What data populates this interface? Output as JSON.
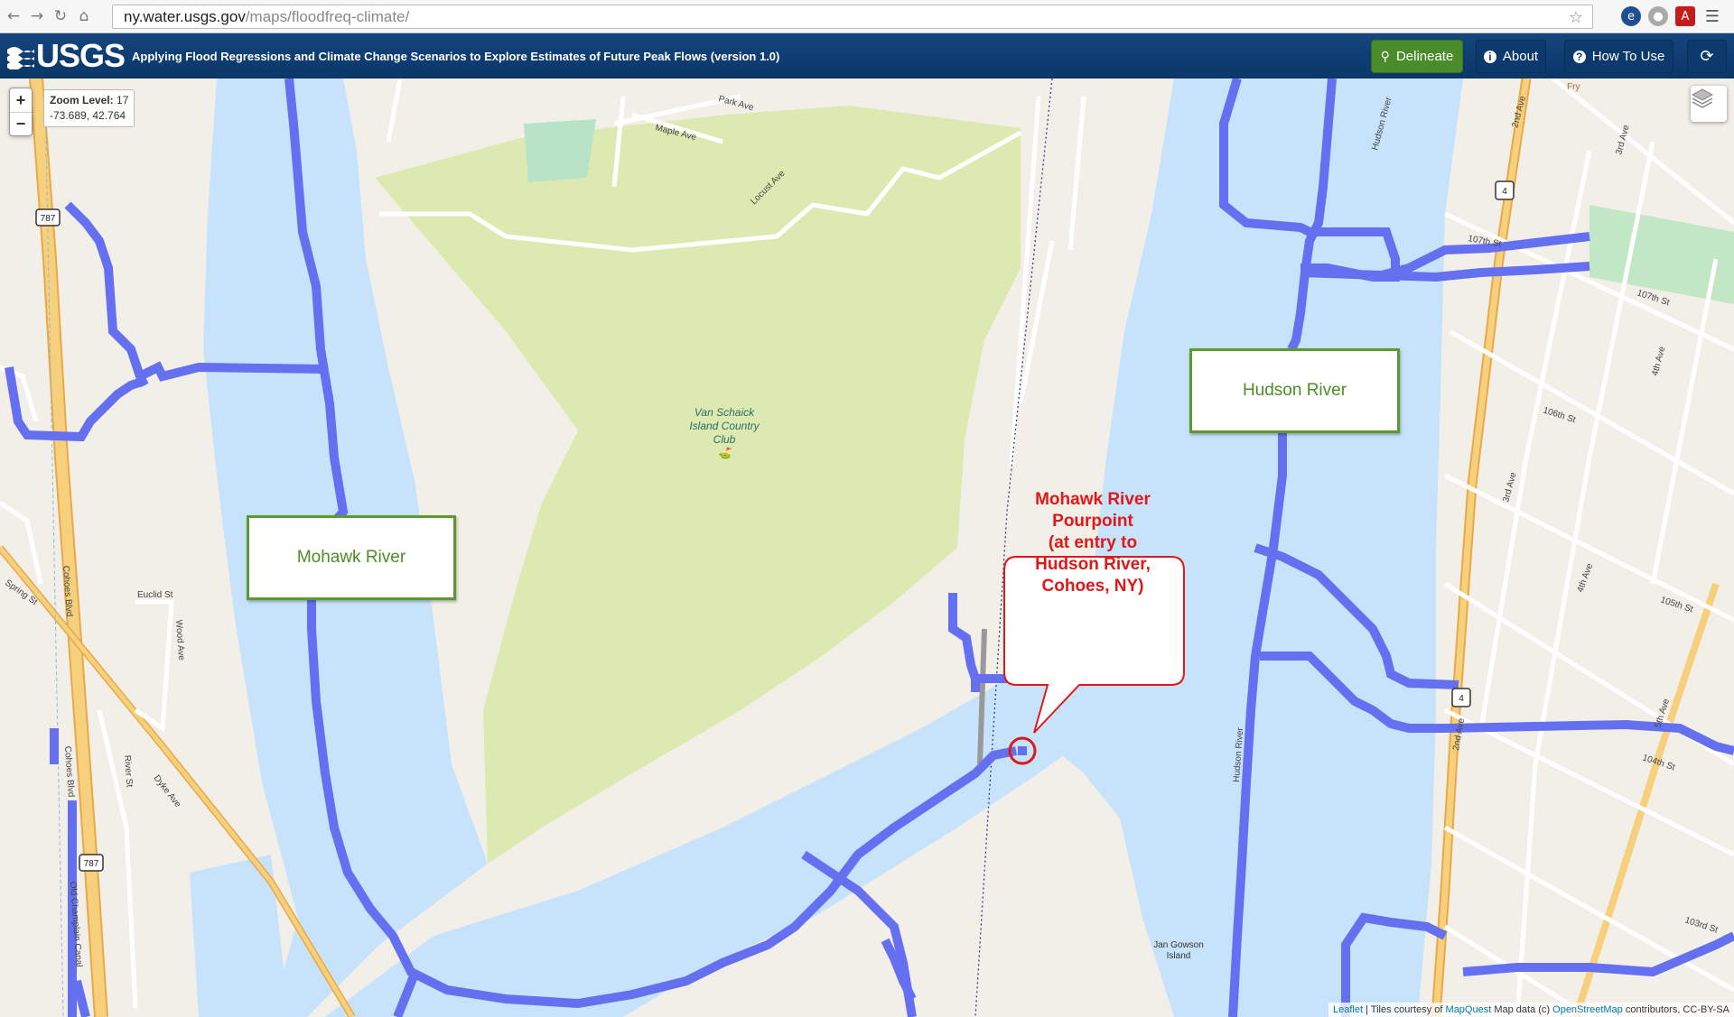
{
  "browser": {
    "url_host": "ny.water.usgs.gov",
    "url_path": "/maps/floodfreq-climate/"
  },
  "header": {
    "logo_text": "USGS",
    "title": "Applying Flood Regressions and Climate Change Scenarios to Explore Estimates of Future Peak Flows (version 1.0)",
    "buttons": {
      "delineate": "Delineate",
      "about": "About",
      "how_to_use": "How To Use"
    }
  },
  "map": {
    "zoom_in": "+",
    "zoom_out": "−",
    "zoom_label": "Zoom Level:",
    "zoom_level": "17",
    "coords": "-73.689, 42.764",
    "labels": {
      "mohawk": "Mohawk River",
      "hudson": "Hudson River"
    },
    "callout": {
      "line1": "Mohawk River",
      "line2": "Pourpoint",
      "line3": "(at entry to",
      "line4": "Hudson River,",
      "line5": "Cohoes, NY)"
    },
    "poi": {
      "club_line1": "Van Schaick",
      "club_line2": "Island Country",
      "club_line3": "Club",
      "island_line1": "Jan Gowson",
      "island_line2": "Island"
    },
    "streets": {
      "park_ave": "Park Ave",
      "maple_ave": "Maple Ave",
      "locust_ave": "Locust Ave",
      "hudson_river_lbl": "Hudson River",
      "second_ave": "2nd Ave",
      "third_ave": "3rd Ave",
      "fourth_ave": "4th Ave",
      "fifth_ave": "5th Ave",
      "st107": "107th St",
      "st106": "106th St",
      "st105": "105th St",
      "st104": "104th St",
      "st103": "103rd St",
      "cohoes_blvd": "Cohoes Blvd",
      "spring_st": "Spring St",
      "euclid_st": "Euclid St",
      "wood_ave": "Wood Ave",
      "dyke_ave": "Dyke Ave",
      "river_st": "River St",
      "old_champlain": "Old Champlain Canal",
      "fry": "Fry",
      "rt787": "787",
      "rt4": "4"
    },
    "attribution": {
      "leaflet": "Leaflet",
      "tiles": " | Tiles courtesy of ",
      "mapquest": "MapQuest",
      "mapdata": " Map data (c) ",
      "osm": "OpenStreetMap",
      "contrib": " contributors, CC-BY-SA"
    }
  },
  "colors": {
    "water": "#c6e3fb",
    "flowline": "#6470f0",
    "golf": "#dceab2",
    "highway": "#f0c45c",
    "label_border": "#5b9a2d",
    "callout_red": "#e01818"
  }
}
